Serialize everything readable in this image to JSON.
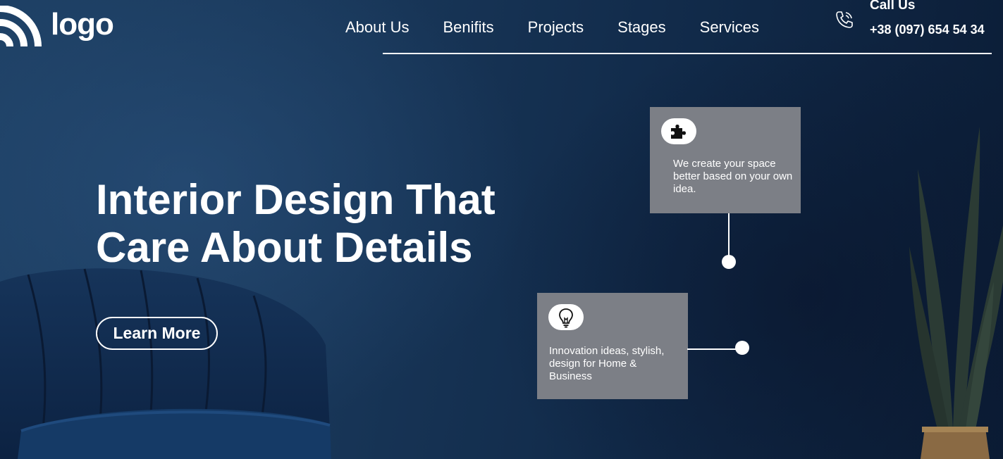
{
  "brand": {
    "logo_text": "logo"
  },
  "nav": {
    "items": [
      "About Us",
      "Benifits",
      "Projects",
      "Stages",
      "Services"
    ]
  },
  "contact": {
    "label": "Call Us",
    "phone": "+38 (097) 654 54 34",
    "icon": "phone-icon"
  },
  "hero": {
    "headline_line1": "Interior Design That",
    "headline_line2": "Care About Details",
    "cta_label": "Learn More"
  },
  "features": [
    {
      "icon": "puzzle-icon",
      "text": "We create your space better based on your own idea."
    },
    {
      "icon": "lightbulb-icon",
      "text": "Innovation ideas, stylish, design for Home & Business"
    }
  ],
  "colors": {
    "background": "#183658",
    "card": "#7c7f86",
    "text": "#ffffff"
  }
}
